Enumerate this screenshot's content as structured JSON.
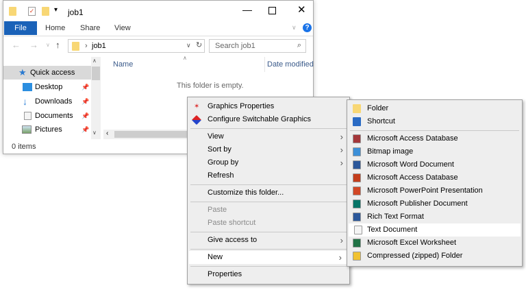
{
  "window": {
    "title": "job1",
    "tabs": [
      "File",
      "Home",
      "Share",
      "View"
    ],
    "address": "job1",
    "search_placeholder": "Search job1",
    "col_name": "Name",
    "col_date": "Date modified",
    "empty_text": "This folder is empty.",
    "status": "0 items",
    "nav": [
      {
        "label": "Quick access",
        "icon": "star-icon"
      },
      {
        "label": "Desktop",
        "icon": "desktop-icon"
      },
      {
        "label": "Downloads",
        "icon": "download-icon"
      },
      {
        "label": "Documents",
        "icon": "documents-icon"
      },
      {
        "label": "Pictures",
        "icon": "pictures-icon"
      }
    ]
  },
  "context_menu": {
    "items": {
      "graphics": "Graphics Properties",
      "switchable": "Configure Switchable Graphics",
      "view": "View",
      "sort": "Sort by",
      "group": "Group by",
      "refresh": "Refresh",
      "customize": "Customize this folder...",
      "paste": "Paste",
      "paste_shortcut": "Paste shortcut",
      "give_access": "Give access to",
      "new": "New",
      "properties": "Properties"
    }
  },
  "new_submenu": {
    "items": [
      "Folder",
      "Shortcut",
      "Microsoft Access Database",
      "Bitmap image",
      "Microsoft Word Document",
      "Microsoft Access Database",
      "Microsoft PowerPoint Presentation",
      "Microsoft Publisher Document",
      "Rich Text Format",
      "Text Document",
      "Microsoft Excel Worksheet",
      "Compressed (zipped) Folder"
    ],
    "highlighted": "Text Document"
  },
  "colors": {
    "file_tab": "#1a62b8",
    "highlight": "#ffffff",
    "menu_bg": "#eeeeee"
  }
}
